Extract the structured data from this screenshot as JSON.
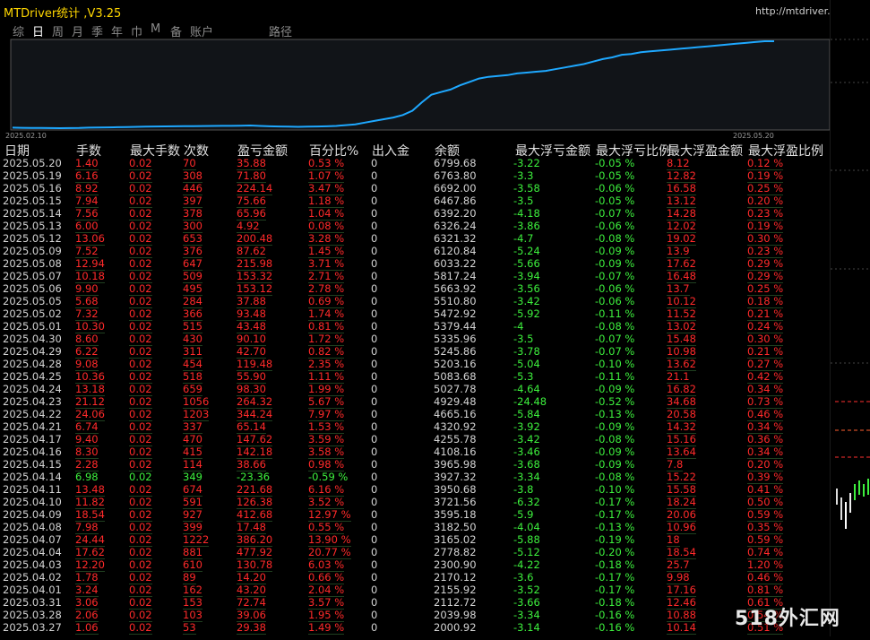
{
  "title": "MTDriver统计 ,V3.25",
  "url": "http://mtdriver.cn",
  "tabs": [
    "综",
    "日",
    "周",
    "月",
    "季",
    "年",
    "巾",
    "M",
    "备",
    "账户",
    "路径"
  ],
  "active_tab": 1,
  "chart_data": {
    "type": "line",
    "x_start_label": "2025.02.10",
    "x_end_label": "2025.05.20",
    "y": [
      2000,
      1990,
      1985,
      1980,
      1975,
      1970,
      1975,
      1980,
      2000,
      2010,
      2020,
      2030,
      2040,
      2050,
      2060,
      2070,
      2075,
      2080,
      2085,
      2090,
      2095,
      2100,
      2105,
      2110,
      2120,
      2130,
      2100,
      2080,
      2070,
      2060,
      2050,
      2060,
      2070,
      2080,
      2100,
      2150,
      2200,
      2300,
      2400,
      2500,
      2600,
      2750,
      3000,
      3500,
      3950,
      4100,
      4250,
      4500,
      4700,
      4900,
      5000,
      5050,
      5100,
      5200,
      5250,
      5300,
      5350,
      5450,
      5550,
      5650,
      5750,
      5900,
      6050,
      6150,
      6300,
      6350,
      6450,
      6500,
      6550,
      6600,
      6650,
      6700,
      6750,
      6800,
      6850,
      6900,
      6950,
      7000,
      7050,
      7100,
      7100
    ],
    "color": "#1ea8ff"
  },
  "columns": [
    "日期",
    "手数",
    "最大手数",
    "次数",
    "盈亏金额",
    "百分比%",
    "出入金",
    "余额",
    "最大浮亏金额",
    "最大浮亏比例",
    "最大浮盈金额",
    "最大浮盈比例"
  ],
  "rows": [
    [
      "2025.05.20",
      "1.40",
      "0.02",
      "70",
      "35.88",
      "0.53 %",
      "0",
      "6799.68",
      "-3.22",
      "-0.05 %",
      "8.12",
      "0.12 %"
    ],
    [
      "2025.05.19",
      "6.16",
      "0.02",
      "308",
      "71.80",
      "1.07 %",
      "0",
      "6763.80",
      "-3.3",
      "-0.05 %",
      "12.82",
      "0.19 %"
    ],
    [
      "2025.05.16",
      "8.92",
      "0.02",
      "446",
      "224.14",
      "3.47 %",
      "0",
      "6692.00",
      "-3.58",
      "-0.06 %",
      "16.58",
      "0.25 %"
    ],
    [
      "2025.05.15",
      "7.94",
      "0.02",
      "397",
      "75.66",
      "1.18 %",
      "0",
      "6467.86",
      "-3.5",
      "-0.05 %",
      "13.12",
      "0.20 %"
    ],
    [
      "2025.05.14",
      "7.56",
      "0.02",
      "378",
      "65.96",
      "1.04 %",
      "0",
      "6392.20",
      "-4.18",
      "-0.07 %",
      "14.28",
      "0.23 %"
    ],
    [
      "2025.05.13",
      "6.00",
      "0.02",
      "300",
      "4.92",
      "0.08 %",
      "0",
      "6326.24",
      "-3.86",
      "-0.06 %",
      "12.02",
      "0.19 %"
    ],
    [
      "2025.05.12",
      "13.06",
      "0.02",
      "653",
      "200.48",
      "3.28 %",
      "0",
      "6321.32",
      "-4.7",
      "-0.08 %",
      "19.02",
      "0.30 %"
    ],
    [
      "2025.05.09",
      "7.52",
      "0.02",
      "376",
      "87.62",
      "1.45 %",
      "0",
      "6120.84",
      "-5.24",
      "-0.09 %",
      "13.9",
      "0.23 %"
    ],
    [
      "2025.05.08",
      "12.94",
      "0.02",
      "647",
      "215.98",
      "3.71 %",
      "0",
      "6033.22",
      "-5.66",
      "-0.09 %",
      "17.62",
      "0.29 %"
    ],
    [
      "2025.05.07",
      "10.18",
      "0.02",
      "509",
      "153.32",
      "2.71 %",
      "0",
      "5817.24",
      "-3.94",
      "-0.07 %",
      "16.48",
      "0.29 %"
    ],
    [
      "2025.05.06",
      "9.90",
      "0.02",
      "495",
      "153.12",
      "2.78 %",
      "0",
      "5663.92",
      "-3.56",
      "-0.06 %",
      "13.7",
      "0.25 %"
    ],
    [
      "2025.05.05",
      "5.68",
      "0.02",
      "284",
      "37.88",
      "0.69 %",
      "0",
      "5510.80",
      "-3.42",
      "-0.06 %",
      "10.12",
      "0.18 %"
    ],
    [
      "2025.05.02",
      "7.32",
      "0.02",
      "366",
      "93.48",
      "1.74 %",
      "0",
      "5472.92",
      "-5.92",
      "-0.11 %",
      "11.52",
      "0.21 %"
    ],
    [
      "2025.05.01",
      "10.30",
      "0.02",
      "515",
      "43.48",
      "0.81 %",
      "0",
      "5379.44",
      "-4",
      "-0.08 %",
      "13.02",
      "0.24 %"
    ],
    [
      "2025.04.30",
      "8.60",
      "0.02",
      "430",
      "90.10",
      "1.72 %",
      "0",
      "5335.96",
      "-3.5",
      "-0.07 %",
      "15.48",
      "0.30 %"
    ],
    [
      "2025.04.29",
      "6.22",
      "0.02",
      "311",
      "42.70",
      "0.82 %",
      "0",
      "5245.86",
      "-3.78",
      "-0.07 %",
      "10.98",
      "0.21 %"
    ],
    [
      "2025.04.28",
      "9.08",
      "0.02",
      "454",
      "119.48",
      "2.35 %",
      "0",
      "5203.16",
      "-5.04",
      "-0.10 %",
      "13.62",
      "0.27 %"
    ],
    [
      "2025.04.25",
      "10.36",
      "0.02",
      "518",
      "55.90",
      "1.11 %",
      "0",
      "5083.68",
      "-5.3",
      "-0.11 %",
      "21.1",
      "0.42 %"
    ],
    [
      "2025.04.24",
      "13.18",
      "0.02",
      "659",
      "98.30",
      "1.99 %",
      "0",
      "5027.78",
      "-4.64",
      "-0.09 %",
      "16.82",
      "0.34 %"
    ],
    [
      "2025.04.23",
      "21.12",
      "0.02",
      "1056",
      "264.32",
      "5.67 %",
      "0",
      "4929.48",
      "-24.48",
      "-0.52 %",
      "34.68",
      "0.73 %"
    ],
    [
      "2025.04.22",
      "24.06",
      "0.02",
      "1203",
      "344.24",
      "7.97 %",
      "0",
      "4665.16",
      "-5.84",
      "-0.13 %",
      "20.58",
      "0.46 %"
    ],
    [
      "2025.04.21",
      "6.74",
      "0.02",
      "337",
      "65.14",
      "1.53 %",
      "0",
      "4320.92",
      "-3.92",
      "-0.09 %",
      "14.32",
      "0.34 %"
    ],
    [
      "2025.04.17",
      "9.40",
      "0.02",
      "470",
      "147.62",
      "3.59 %",
      "0",
      "4255.78",
      "-3.42",
      "-0.08 %",
      "15.16",
      "0.36 %"
    ],
    [
      "2025.04.16",
      "8.30",
      "0.02",
      "415",
      "142.18",
      "3.58 %",
      "0",
      "4108.16",
      "-3.46",
      "-0.09 %",
      "13.64",
      "0.34 %"
    ],
    [
      "2025.04.15",
      "2.28",
      "0.02",
      "114",
      "38.66",
      "0.98 %",
      "0",
      "3965.98",
      "-3.68",
      "-0.09 %",
      "7.8",
      "0.20 %"
    ],
    [
      "2025.04.14",
      "6.98",
      "0.02",
      "349",
      "-23.36",
      "-0.59 %",
      "0",
      "3927.32",
      "-3.34",
      "-0.08 %",
      "15.22",
      "0.39 %"
    ],
    [
      "2025.04.11",
      "13.48",
      "0.02",
      "674",
      "221.68",
      "6.16 %",
      "0",
      "3950.68",
      "-3.8",
      "-0.10 %",
      "15.58",
      "0.41 %"
    ],
    [
      "2025.04.10",
      "11.82",
      "0.02",
      "591",
      "126.38",
      "3.52 %",
      "0",
      "3721.56",
      "-6.32",
      "-0.17 %",
      "18.24",
      "0.50 %"
    ],
    [
      "2025.04.09",
      "18.54",
      "0.02",
      "927",
      "412.68",
      "12.97 %",
      "0",
      "3595.18",
      "-5.9",
      "-0.17 %",
      "20.06",
      "0.59 %"
    ],
    [
      "2025.04.08",
      "7.98",
      "0.02",
      "399",
      "17.48",
      "0.55 %",
      "0",
      "3182.50",
      "-4.04",
      "-0.13 %",
      "10.96",
      "0.35 %"
    ],
    [
      "2025.04.07",
      "24.44",
      "0.02",
      "1222",
      "386.20",
      "13.90 %",
      "0",
      "3165.02",
      "-5.88",
      "-0.19 %",
      "18",
      "0.59 %"
    ],
    [
      "2025.04.04",
      "17.62",
      "0.02",
      "881",
      "477.92",
      "20.77 %",
      "0",
      "2778.82",
      "-5.12",
      "-0.20 %",
      "18.54",
      "0.74 %"
    ],
    [
      "2025.04.03",
      "12.20",
      "0.02",
      "610",
      "130.78",
      "6.03 %",
      "0",
      "2300.90",
      "-4.22",
      "-0.18 %",
      "25.7",
      "1.20 %"
    ],
    [
      "2025.04.02",
      "1.78",
      "0.02",
      "89",
      "14.20",
      "0.66 %",
      "0",
      "2170.12",
      "-3.6",
      "-0.17 %",
      "9.98",
      "0.46 %"
    ],
    [
      "2025.04.01",
      "3.24",
      "0.02",
      "162",
      "43.20",
      "2.04 %",
      "0",
      "2155.92",
      "-3.52",
      "-0.17 %",
      "17.16",
      "0.81 %"
    ],
    [
      "2025.03.31",
      "3.06",
      "0.02",
      "153",
      "72.74",
      "3.57 %",
      "0",
      "2112.72",
      "-3.66",
      "-0.18 %",
      "12.46",
      "0.61 %"
    ],
    [
      "2025.03.28",
      "2.06",
      "0.02",
      "103",
      "39.06",
      "1.95 %",
      "0",
      "2039.98",
      "-3.34",
      "-0.16 %",
      "10.88",
      "0.54 %"
    ],
    [
      "2025.03.27",
      "1.06",
      "0.02",
      "53",
      "29.38",
      "1.49 %",
      "0",
      "2000.92",
      "-3.14",
      "-0.16 %",
      "10.14",
      "0.51 %"
    ]
  ],
  "watermark": "518外汇网",
  "colors": {
    "loss": "#ff2a2a",
    "profit": "#3df03d",
    "accent": "#ffd700",
    "line": "#1ea8ff"
  }
}
